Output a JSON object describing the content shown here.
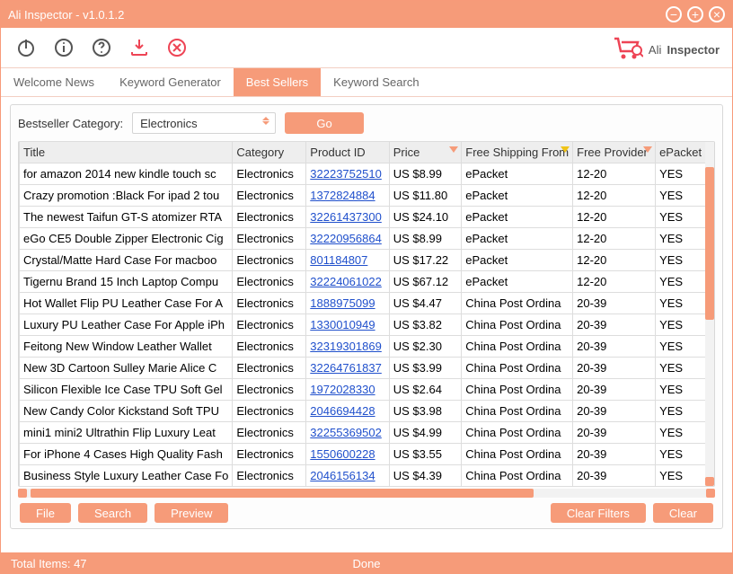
{
  "window": {
    "title": "Ali Inspector - v1.0.1.2"
  },
  "logo": {
    "brand": "Ali",
    "product": "Inspector"
  },
  "tabs": [
    "Welcome News",
    "Keyword Generator",
    "Best Sellers",
    "Keyword Search"
  ],
  "active_tab_index": 2,
  "category_label": "Bestseller Category:",
  "category_value": "Electronics",
  "go_label": "Go",
  "columns": [
    "Title",
    "Category",
    "Product ID",
    "Price",
    "Free Shipping From",
    "Free Provider",
    "ePacket"
  ],
  "rows": [
    {
      "title": "for amazon 2014 new kindle touch sc",
      "cat": "Electronics",
      "pid": "32223752510",
      "price": "US $8.99",
      "ship": "ePacket",
      "prov": "12-20",
      "ep": "YES"
    },
    {
      "title": "Crazy promotion :Black For ipad 2 tou",
      "cat": "Electronics",
      "pid": "1372824884",
      "price": "US $11.80",
      "ship": "ePacket",
      "prov": "12-20",
      "ep": "YES"
    },
    {
      "title": "The newest Taifun GT-S atomizer RTA",
      "cat": "Electronics",
      "pid": "32261437300",
      "price": "US $24.10",
      "ship": "ePacket",
      "prov": "12-20",
      "ep": "YES"
    },
    {
      "title": "eGo CE5 Double Zipper Electronic Cig",
      "cat": "Electronics",
      "pid": "32220956864",
      "price": "US $8.99",
      "ship": "ePacket",
      "prov": "12-20",
      "ep": "YES"
    },
    {
      "title": "Crystal/Matte Hard Case For macboo",
      "cat": "Electronics",
      "pid": "801184807",
      "price": "US $17.22",
      "ship": "ePacket",
      "prov": "12-20",
      "ep": "YES"
    },
    {
      "title": "Tigernu Brand 15 Inch Laptop Compu",
      "cat": "Electronics",
      "pid": "32224061022",
      "price": "US $67.12",
      "ship": "ePacket",
      "prov": "12-20",
      "ep": "YES"
    },
    {
      "title": "Hot Wallet Flip PU Leather Case For A",
      "cat": "Electronics",
      "pid": "1888975099",
      "price": "US $4.47",
      "ship": "China Post Ordina",
      "prov": "20-39",
      "ep": "YES"
    },
    {
      "title": "Luxury PU Leather Case For Apple iPh",
      "cat": "Electronics",
      "pid": "1330010949",
      "price": "US $3.82",
      "ship": "China Post Ordina",
      "prov": "20-39",
      "ep": "YES"
    },
    {
      "title": "Feitong New Window Leather Wallet",
      "cat": "Electronics",
      "pid": "32319301869",
      "price": "US $2.30",
      "ship": "China Post Ordina",
      "prov": "20-39",
      "ep": "YES"
    },
    {
      "title": "New 3D Cartoon Sulley Marie Alice C",
      "cat": "Electronics",
      "pid": "32264761837",
      "price": "US $3.99",
      "ship": "China Post Ordina",
      "prov": "20-39",
      "ep": "YES"
    },
    {
      "title": "Silicon Flexible Ice Case TPU Soft Gel",
      "cat": "Electronics",
      "pid": "1972028330",
      "price": "US $2.64",
      "ship": "China Post Ordina",
      "prov": "20-39",
      "ep": "YES"
    },
    {
      "title": "New Candy Color Kickstand Soft TPU",
      "cat": "Electronics",
      "pid": "2046694428",
      "price": "US $3.98",
      "ship": "China Post Ordina",
      "prov": "20-39",
      "ep": "YES"
    },
    {
      "title": "mini1 mini2 Ultrathin Flip Luxury Leat",
      "cat": "Electronics",
      "pid": "32255369502",
      "price": "US $4.99",
      "ship": "China Post Ordina",
      "prov": "20-39",
      "ep": "YES"
    },
    {
      "title": "For iPhone 4 Cases High Quality Fash",
      "cat": "Electronics",
      "pid": "1550600228",
      "price": "US $3.55",
      "ship": "China Post Ordina",
      "prov": "20-39",
      "ep": "YES"
    },
    {
      "title": "Business Style Luxury Leather Case Fo",
      "cat": "Electronics",
      "pid": "2046156134",
      "price": "US $4.39",
      "ship": "China Post Ordina",
      "prov": "20-39",
      "ep": "YES"
    }
  ],
  "buttons": {
    "file": "File",
    "search": "Search",
    "preview": "Preview",
    "clear_filters": "Clear Filters",
    "clear": "Clear"
  },
  "status": {
    "total": "Total Items: 47",
    "state": "Done"
  }
}
